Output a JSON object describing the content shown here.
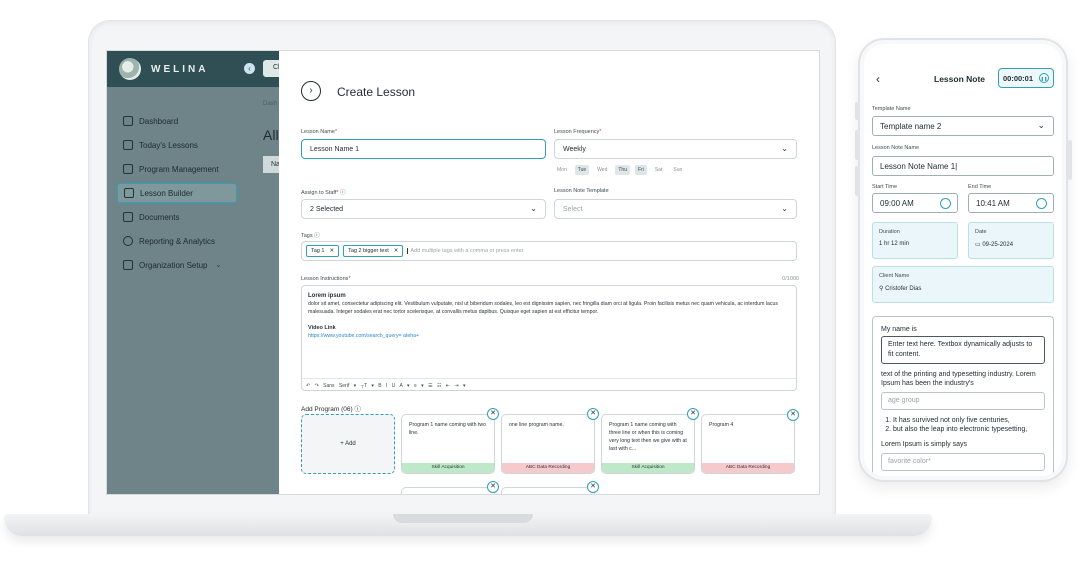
{
  "laptop": {
    "brand": "WELINA",
    "bg_chip": "Cl",
    "bg_breadcrumb": "Dash",
    "bg_title": "All",
    "bg_na": "Na",
    "nav": [
      {
        "label": "Dashboard"
      },
      {
        "label": "Today's Lessons"
      },
      {
        "label": "Program Management"
      },
      {
        "label": "Lesson Builder"
      },
      {
        "label": "Documents"
      },
      {
        "label": "Reporting & Analytics"
      },
      {
        "label": "Organization Setup"
      }
    ],
    "form": {
      "title": "Create Lesson",
      "lesson_name_label": "Lesson Name",
      "lesson_name_value": "Lesson Name 1",
      "frequency_label": "Lesson Frequency",
      "frequency_value": "Weekly",
      "days": [
        "Mon",
        "Tue",
        "Wed",
        "Thu",
        "Fri",
        "Sat",
        "Sun"
      ],
      "assign_label": "Assign to Staff",
      "assign_value": "2 Selected",
      "template_label": "Lesson Note Template",
      "template_placeholder": "Select",
      "tags_label": "Tags",
      "tags": [
        "Tag 1",
        "Tag 2 bigger text"
      ],
      "tags_placeholder": "Add multiple tags with a comma or press enter.",
      "instructions_label": "Lesson Instructions",
      "instructions_count": "0/1000",
      "instructions_heading": "Lorem ipsum",
      "instructions_body": "dolor sit amet, consectetur adipiscing elit. Vestibulum vulputate, nisl ut bibendum sodales, leo est dignissim sapien, nec fringilla diam orci at ligula. Proin facilisis metus nec quam vehicula, ac interdum lacus malesuada. Integer sodales erat nec tortor scelerisque, at convallis metus dapibus. Quisque eget sapien at est efficitur tempor.",
      "video_heading": "Video Link",
      "video_url": "https://www.youtube.com/search_query= ateha+",
      "toolbar": "↶ ↷  Sans Serif ▾  ┬T ▾  B  I  U  A ▾  ≡ ▾  ☰  ☷  ⇤  ⇥  ▾",
      "program_label": "Add Program (06)",
      "add_label": "+ Add",
      "programs": [
        {
          "text": "Program 1 name coming with two line.",
          "tag": "Skill Acquisition"
        },
        {
          "text": "one line program name.",
          "tag": "ABC Data Recording"
        },
        {
          "text": "Program 1 name coming with three line or when this is coming very long text then we give with at last with c...",
          "tag": "Skill Acquisition"
        },
        {
          "text": "Program 4",
          "tag": "ABC Data Recording"
        }
      ]
    }
  },
  "phone": {
    "title": "Lesson Note",
    "timer": "00:00:01",
    "template_label": "Template Name",
    "template_value": "Template name 2",
    "note_name_label": "Lesson Note Name",
    "note_name_value": "Lesson Note Name 1",
    "start_label": "Start Time",
    "start_value": "09:00 AM",
    "end_label": "End Time",
    "end_value": "10:41 AM",
    "duration_label": "Duration",
    "duration_value": "1 hr 12 min",
    "date_label": "Date",
    "date_value": "09-25-2024",
    "client_label": "Client Name",
    "client_value": "Cristofer Dias",
    "card": {
      "line1": "My name is",
      "input1": "Enter text here. Textbox dynamically adjusts to fit content.",
      "line2": "text of the printing and typesetting industry. Lorem Ipsum has  been the industry's",
      "input2_placeholder": "age group",
      "list": [
        "It has survived not only five centuries,",
        "but also the leap into electronic typesetting,"
      ],
      "line3": "Lorem Ipsum is simply says",
      "input3_placeholder": "favorite color*"
    }
  }
}
